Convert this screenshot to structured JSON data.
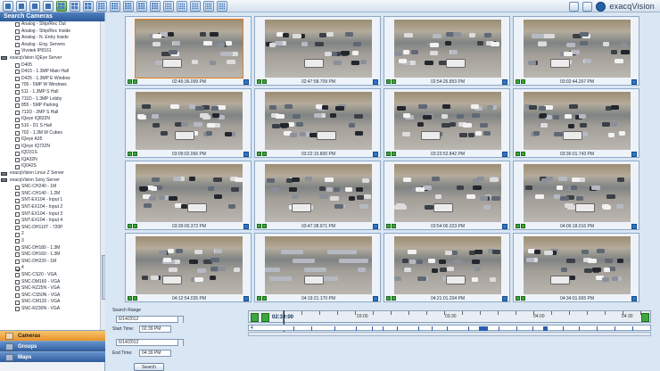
{
  "toolbar": {
    "icons": [
      "live-view-icon",
      "search-icon",
      "config-icon",
      "playback-icon",
      "layout-1-icon",
      "layout-2-icon",
      "layout-3-icon",
      "layout-4-icon",
      "layout-6-icon",
      "layout-9-icon",
      "layout-10-icon",
      "layout-12-icon",
      "layout-13-icon",
      "layout-16-icon",
      "layout-20-icon",
      "layout-25-icon",
      "layout-36-icon"
    ],
    "brand": "exacqVision"
  },
  "sidebar": {
    "title": "Search Cameras",
    "tree": [
      {
        "label": "Analog - Ship/Rec Out",
        "level": 2,
        "checked": false
      },
      {
        "label": "Analog - Ship/Rec Inside",
        "level": 2,
        "checked": false
      },
      {
        "label": "Analog - N. Entry Inside",
        "level": 2,
        "checked": false
      },
      {
        "label": "Analog - Eng. Servers",
        "level": 2,
        "checked": false
      },
      {
        "label": "Vivotek IP8161",
        "level": 2,
        "checked": false
      },
      {
        "label": "exacqVision IQEye Server",
        "level": 1,
        "server": true
      },
      {
        "label": "D405",
        "level": 2,
        "checked": false
      },
      {
        "label": "D415 - 1.3MP Main Hall",
        "level": 2,
        "checked": false
      },
      {
        "label": "D425 - 1.3MP E Window",
        "level": 2,
        "checked": false
      },
      {
        "label": "705 - 5MP W Windows",
        "level": 2,
        "checked": false
      },
      {
        "label": "511 - 1.3MP S Hall",
        "level": 2,
        "checked": false
      },
      {
        "label": "711D - 1.3MP Lobby",
        "level": 2,
        "checked": false
      },
      {
        "label": "855 - 5MP Parking",
        "level": 2,
        "checked": false
      },
      {
        "label": "712D - 2MP S Hall",
        "level": 2,
        "checked": false
      },
      {
        "label": "IQeye IQ832N",
        "level": 2,
        "checked": false
      },
      {
        "label": "510 - D1 S Hall",
        "level": 2,
        "checked": false
      },
      {
        "label": "702 - 1.3M W Cubes",
        "level": 2,
        "checked": false
      },
      {
        "label": "IQeye A35",
        "level": 2,
        "checked": false
      },
      {
        "label": "IQeye IQ732N",
        "level": 2,
        "checked": false
      },
      {
        "label": "IQD31S",
        "level": 2,
        "checked": false
      },
      {
        "label": "IQA32N",
        "level": 2,
        "checked": false
      },
      {
        "label": "IQ042S",
        "level": 2,
        "checked": false
      },
      {
        "label": "exacqVision Linux Z Server",
        "level": 1,
        "server": true
      },
      {
        "label": "exacqVision Sony Server",
        "level": 1,
        "server": true
      },
      {
        "label": "SNC-CH240 - 1M",
        "level": 2,
        "checked": false
      },
      {
        "label": "SNC-CH140 - 1.2M",
        "level": 2,
        "checked": false
      },
      {
        "label": "SNT-EX104 - Input 1",
        "level": 2,
        "checked": false
      },
      {
        "label": "SNT-EX104 - Input 2",
        "level": 2,
        "checked": false
      },
      {
        "label": "SNT-EX104 - Input 3",
        "level": 2,
        "checked": false
      },
      {
        "label": "SNT-EX104 - Input 4",
        "level": 2,
        "checked": false
      },
      {
        "label": "SNC-DH110T - 720P",
        "level": 2,
        "checked": false
      },
      {
        "label": "2",
        "level": 2,
        "checked": false
      },
      {
        "label": "3",
        "level": 2,
        "checked": false
      },
      {
        "label": "SNC-DH180 - 1.3M",
        "level": 2,
        "checked": false
      },
      {
        "label": "SNC-DH160 - 1.3M",
        "level": 2,
        "checked": false
      },
      {
        "label": "SNC-DH220 - 1M",
        "level": 2,
        "checked": false
      },
      {
        "label": "4",
        "level": 2,
        "checked": true
      },
      {
        "label": "SNC-CS20 - VGA",
        "level": 2,
        "checked": false
      },
      {
        "label": "SNC-DM160 - VGA",
        "level": 2,
        "checked": false
      },
      {
        "label": "SNC-RZ25N - VGA",
        "level": 2,
        "checked": false
      },
      {
        "label": "SNC-CS50N - VGA",
        "level": 2,
        "checked": false
      },
      {
        "label": "SNC-CM120 - VGA",
        "level": 2,
        "checked": false
      },
      {
        "label": "SNC-RZ30N - VGA",
        "level": 2,
        "checked": false
      }
    ],
    "nav": {
      "cameras": "Cameras",
      "groups": "Groups",
      "maps": "Maps"
    }
  },
  "grid": {
    "timestamps": [
      "02:45:36.099 PM",
      "02:47:58.709 PM",
      "02:54:26.853 PM",
      "03:02:44.267 PM",
      "03:09:02.066 PM",
      "03:22:15.800 PM",
      "03:23:52.842 PM",
      "03:36:01.743 PM",
      "03:39:00.372 PM",
      "03:47:38.971 PM",
      "03:54:00.323 PM",
      "04:06:18.016 PM",
      "04:12:54.035 PM",
      "04:19:21.170 PM",
      "04:21:01.204 PM",
      "04:34:01.665 PM"
    ],
    "selected_index": 0
  },
  "search": {
    "title": "Search Range",
    "date_top": "6/14/2012",
    "start_label": "Start Time:",
    "start_time": "02:39 PM",
    "date_bottom": "6/14/2012",
    "end_label": "End Time:",
    "end_time": "04:39 PM",
    "button": "Search"
  },
  "timeline": {
    "current": "02:39:00",
    "labels": [
      "03:00",
      "03:30",
      "04:00",
      "04:30"
    ],
    "track_number": "4"
  },
  "colors": {
    "accent": "#e07d24",
    "header_blue": "#2d5a98",
    "green": "#3ea83e"
  }
}
